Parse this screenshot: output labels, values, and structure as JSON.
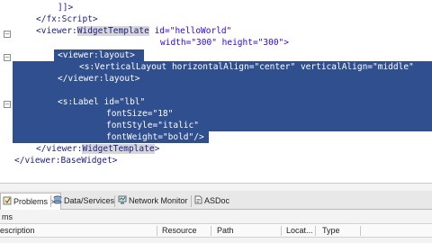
{
  "editor": {
    "lines": [
      {
        "text": "]]>"
      },
      {
        "text": "</fx:Script>"
      },
      {
        "pre": "<viewer:",
        "hl": "WidgetTemplate",
        "post": " id=\"helloWorld\""
      },
      {
        "text": "width=\"300\" height=\"300\">"
      },
      {
        "text": "<viewer:layout>"
      },
      {
        "text": "<s:VerticalLayout horizontalAlign=\"center\" verticalAlign=\"middle\""
      },
      {
        "text": "</viewer:layout>"
      },
      {
        "text": ""
      },
      {
        "text": "<s:Label id=\"lbl\""
      },
      {
        "text": "fontSize=\"18\""
      },
      {
        "text": "fontStyle=\"italic\""
      },
      {
        "text": "fontWeight=\"bold\"/>"
      },
      {
        "pre": "</viewer:",
        "hl": "WidgetTemplate",
        "post": ">"
      },
      {
        "text": "</viewer:BaseWidget>"
      }
    ]
  },
  "panel": {
    "tabs": [
      {
        "label": "Problems",
        "icon": "problems-icon"
      },
      {
        "label": "Data/Services",
        "icon": "data-services-icon"
      },
      {
        "label": "Network Monitor",
        "icon": "network-monitor-icon"
      },
      {
        "label": "ASDoc",
        "icon": "asdoc-icon"
      }
    ],
    "close_glyph": "✕",
    "count_text": "ms",
    "columns": [
      "escription",
      "Resource",
      "Path",
      "Locat...",
      "Type"
    ]
  },
  "colors": {
    "selection": "#2f4f8f",
    "tag": "#1b1b8c",
    "value": "#2a00ff",
    "match_highlight": "#d6d6d6"
  }
}
